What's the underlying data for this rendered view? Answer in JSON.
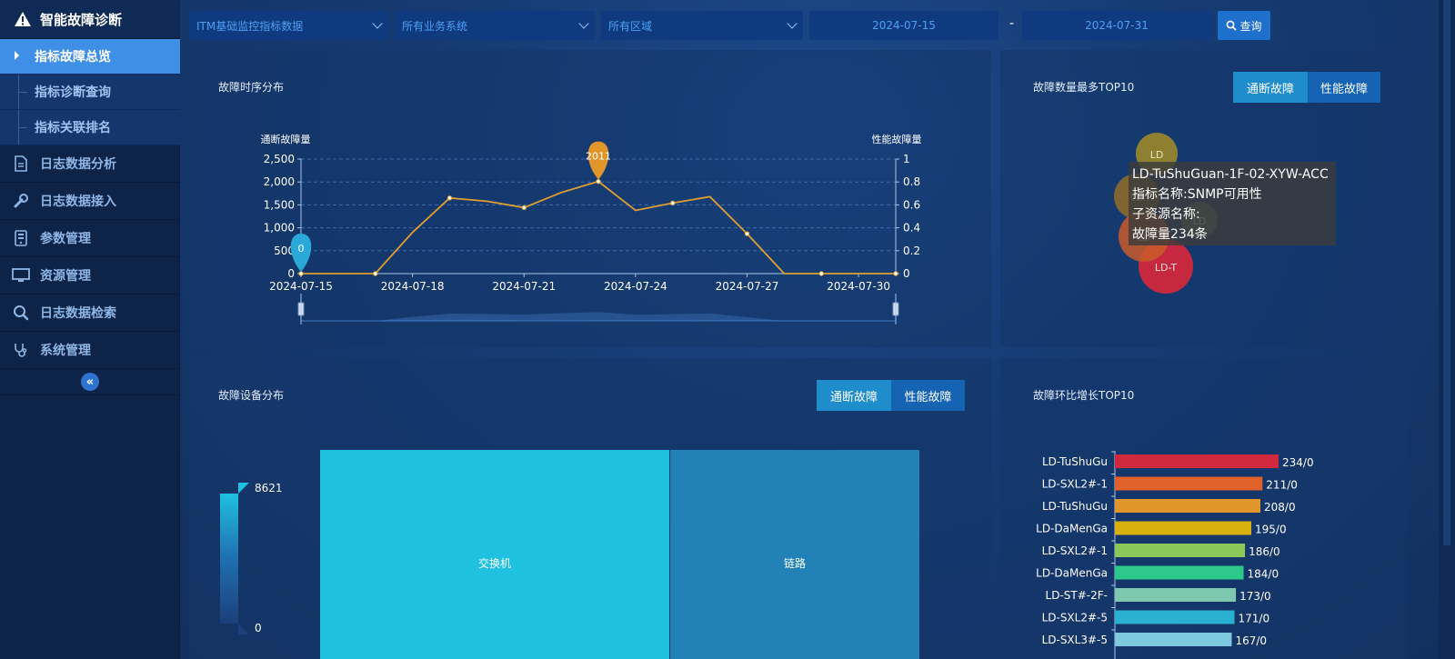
{
  "sidebar": {
    "title": "智能故障诊断",
    "sub_items": [
      {
        "label": "指标故障总览",
        "active": true
      },
      {
        "label": "指标诊断查询",
        "active": false
      },
      {
        "label": "指标关联排名",
        "active": false
      }
    ],
    "nav_items": [
      {
        "label": "日志数据分析",
        "icon": "document-icon"
      },
      {
        "label": "日志数据接入",
        "icon": "wrench-icon"
      },
      {
        "label": "参数管理",
        "icon": "tablet-icon"
      },
      {
        "label": "资源管理",
        "icon": "monitor-icon"
      },
      {
        "label": "日志数据检索",
        "icon": "search-icon"
      },
      {
        "label": "系统管理",
        "icon": "stethoscope-icon"
      }
    ],
    "collapse_icon": "«"
  },
  "filters": {
    "dataset": "ITM基础监控指标数据",
    "business": "所有业务系统",
    "region": "所有区域",
    "start_date": "2024-07-15",
    "separator": "-",
    "end_date": "2024-07-31",
    "query_label": "查询"
  },
  "timeline_panel": {
    "title": "故障时序分布",
    "chart_data": {
      "type": "line",
      "ylabel_left": "通断故障量",
      "ylabel_right": "性能故障量",
      "x": [
        "2024-07-15",
        "2024-07-16",
        "2024-07-17",
        "2024-07-18",
        "2024-07-19",
        "2024-07-20",
        "2024-07-21",
        "2024-07-22",
        "2024-07-23",
        "2024-07-24",
        "2024-07-25",
        "2024-07-26",
        "2024-07-27",
        "2024-07-28",
        "2024-07-29",
        "2024-07-30",
        "2024-07-31"
      ],
      "x_tick_labels": [
        "2024-07-15",
        "2024-07-18",
        "2024-07-21",
        "2024-07-24",
        "2024-07-27",
        "2024-07-30"
      ],
      "y_left_ticks": [
        "0",
        "500",
        "1,000",
        "1,500",
        "2,000",
        "2,500"
      ],
      "y_right_ticks": [
        "0",
        "0.2",
        "0.4",
        "0.6",
        "0.8",
        "1"
      ],
      "ylim_left": [
        0,
        2500
      ],
      "ylim_right": [
        0,
        1
      ],
      "series": [
        {
          "values": [
            0,
            0,
            0,
            900,
            1650,
            1580,
            1440,
            1770,
            2011,
            1380,
            1540,
            1680,
            870,
            0,
            0,
            0,
            0
          ],
          "color": "#e0a030"
        }
      ],
      "markers": [
        {
          "label": "0",
          "x_index": 0,
          "value": 0,
          "color": "#2aa9d9"
        },
        {
          "label": "2011",
          "x_index": 8,
          "value": 2011,
          "color": "#e0962a"
        }
      ],
      "grid": true
    }
  },
  "top10_panel": {
    "title": "故障数量最多TOP10",
    "tabs": [
      {
        "label": "通断故障",
        "active": true
      },
      {
        "label": "性能故障",
        "active": false
      }
    ],
    "bubbles": [
      {
        "label": "LD",
        "color": "#9a8a2a"
      },
      {
        "label": "LD",
        "color": "#8a6a2a"
      },
      {
        "label": "LD",
        "color": "#4f7a6a"
      },
      {
        "label": "LD",
        "color": "#c85a2a"
      },
      {
        "label": "LD-T",
        "color": "#d0283c"
      }
    ],
    "tooltip": {
      "line1": "LD-TuShuGuan-1F-02-XYW-ACC",
      "line2": "指标名称:SNMP可用性",
      "line3": "子资源名称:",
      "line4": "故障量234条"
    }
  },
  "device_panel": {
    "title": "故障设备分布",
    "tabs": [
      {
        "label": "通断故障",
        "active": true
      },
      {
        "label": "性能故障",
        "active": false
      }
    ],
    "legend_max": "8621",
    "legend_min": "0",
    "treemap": [
      {
        "label": "交换机",
        "color": "#1fc0e0"
      },
      {
        "label": "链路",
        "color": "#2282b8"
      }
    ]
  },
  "growth_panel": {
    "title": "故障环比增长TOP10",
    "chart_data": {
      "type": "bar",
      "orientation": "horizontal",
      "categories": [
        "LD-TuShuGu",
        "LD-SXL2#-1",
        "LD-TuShuGu",
        "LD-DaMenGa",
        "LD-SXL2#-1",
        "LD-DaMenGa",
        "LD-ST#-2F-",
        "LD-SXL2#-5",
        "LD-SXL3#-5"
      ],
      "values": [
        234,
        211,
        208,
        195,
        186,
        184,
        173,
        171,
        167
      ],
      "value_labels": [
        "234/0",
        "211/0",
        "208/0",
        "195/0",
        "186/0",
        "184/0",
        "173/0",
        "171/0",
        "167/0"
      ],
      "colors": [
        "#d0283c",
        "#e0622a",
        "#e0962a",
        "#d8b010",
        "#8ac85a",
        "#2ec88a",
        "#7ec8b0",
        "#2ab0d0",
        "#7ec8e0"
      ],
      "xlim": [
        0,
        234
      ]
    }
  }
}
